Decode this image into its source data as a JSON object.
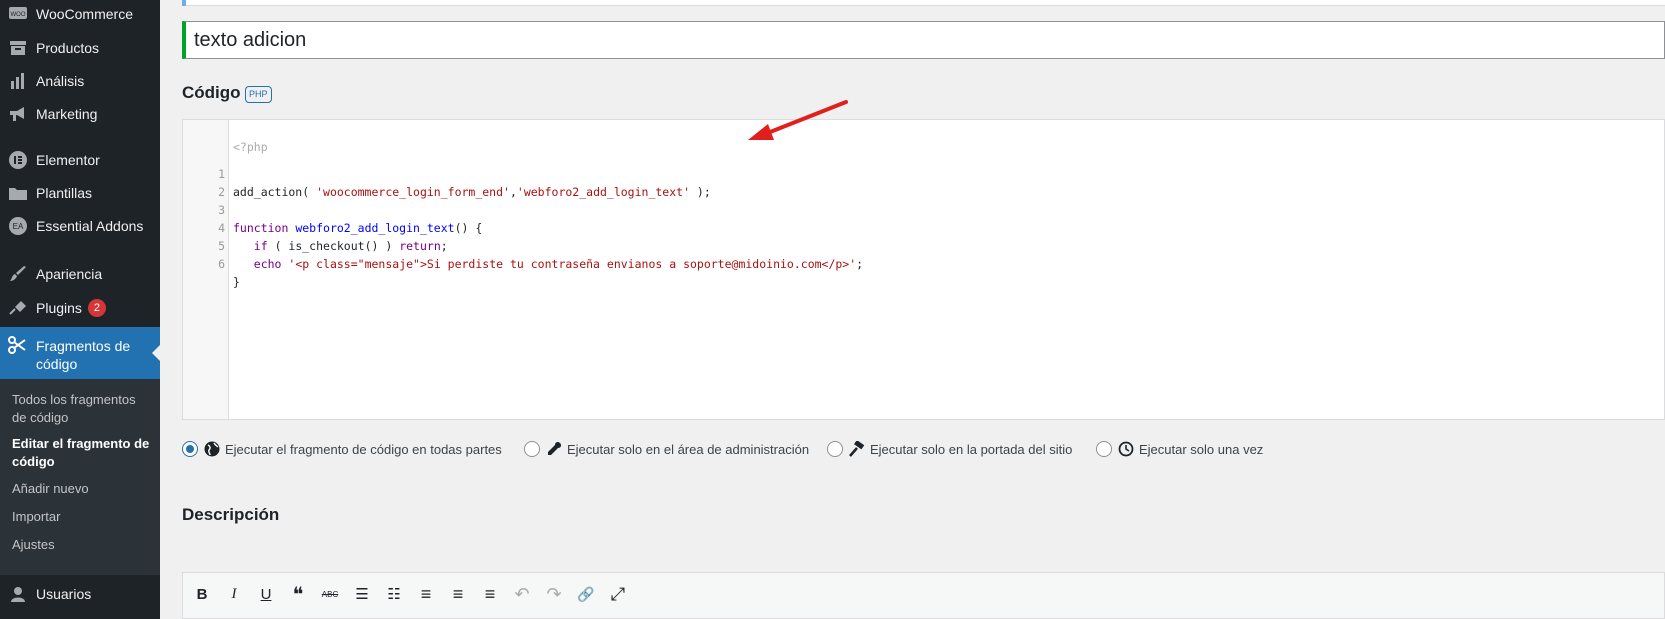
{
  "sidebar": {
    "items": [
      {
        "label": "WooCommerce",
        "icon": "woo-icon"
      },
      {
        "label": "Productos",
        "icon": "archive-icon"
      },
      {
        "label": "Análisis",
        "icon": "chart-bar-icon"
      },
      {
        "label": "Marketing",
        "icon": "megaphone-icon"
      },
      {
        "label": "Elementor",
        "icon": "elementor-icon"
      },
      {
        "label": "Plantillas",
        "icon": "folder-icon"
      },
      {
        "label": "Essential Addons",
        "icon": "ea-icon"
      },
      {
        "label": "Apariencia",
        "icon": "brush-icon"
      },
      {
        "label": "Plugins",
        "icon": "plug-icon",
        "badge": "2"
      },
      {
        "label": "Usuarios",
        "icon": "user-icon"
      }
    ],
    "active": {
      "label": "Fragmentos de código",
      "icon": "scissors-icon"
    },
    "submenu": [
      {
        "label": "Todos los fragmentos de código"
      },
      {
        "label": "Editar el fragmento de código",
        "current": true
      },
      {
        "label": "Añadir nuevo"
      },
      {
        "label": "Importar"
      },
      {
        "label": "Ajustes"
      }
    ]
  },
  "snippet": {
    "title": "texto adicion"
  },
  "code_section": {
    "heading": "Código",
    "badge": "PHP",
    "prefix": "<?php",
    "lines": [
      "add_action( 'woocommerce_login_form_end','webforo2_add_login_text' );",
      "",
      "function webforo2_add_login_text() {",
      "   if ( is_checkout() ) return;",
      "   echo '<p class=\"mensaje\">Si perdiste tu contraseña envianos a soporte@midoinio.com</p>';",
      "}"
    ]
  },
  "scope_options": [
    {
      "label": "Ejecutar el fragmento de código en todas partes",
      "icon": "globe-icon",
      "checked": true
    },
    {
      "label": "Ejecutar solo en el área de administración",
      "icon": "wrench-icon",
      "checked": false
    },
    {
      "label": "Ejecutar solo en la portada del sitio",
      "icon": "hammer-icon",
      "checked": false
    },
    {
      "label": "Ejecutar solo una vez",
      "icon": "clock-icon",
      "checked": false
    }
  ],
  "description": {
    "heading": "Descripción"
  },
  "editor_toolbar": [
    {
      "name": "bold",
      "glyph": "B"
    },
    {
      "name": "italic",
      "glyph": "I"
    },
    {
      "name": "underline",
      "glyph": "U"
    },
    {
      "name": "blockquote",
      "glyph": "❝"
    },
    {
      "name": "strikethrough",
      "glyph": "ABC"
    },
    {
      "name": "bullet-list",
      "glyph": "☰"
    },
    {
      "name": "numbered-list",
      "glyph": "☷"
    },
    {
      "name": "align-left",
      "glyph": "≡"
    },
    {
      "name": "align-center",
      "glyph": "≡"
    },
    {
      "name": "align-right",
      "glyph": "≡"
    },
    {
      "name": "undo",
      "glyph": "↶"
    },
    {
      "name": "redo",
      "glyph": "↷"
    },
    {
      "name": "link",
      "glyph": "🔗"
    },
    {
      "name": "fullscreen",
      "glyph": "⤢"
    }
  ],
  "colors": {
    "sidebar_bg": "#1d2327",
    "active_bg": "#2271b1",
    "badge": "#d63638",
    "title_accent": "#00a32a",
    "arrow": "#e0201e"
  }
}
